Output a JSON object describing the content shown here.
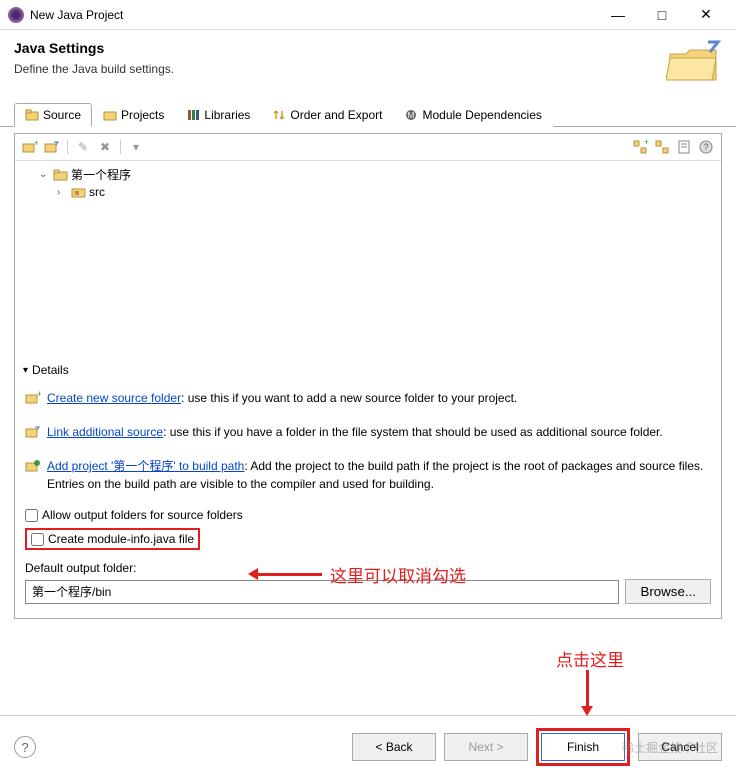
{
  "window": {
    "title": "New Java Project"
  },
  "header": {
    "title": "Java Settings",
    "subtitle": "Define the Java build settings."
  },
  "tabs": {
    "source": "Source",
    "projects": "Projects",
    "libraries": "Libraries",
    "order": "Order and Export",
    "module": "Module Dependencies"
  },
  "tree": {
    "root": "第一个程序",
    "child": "src"
  },
  "details": {
    "header": "Details",
    "create_link": "Create new source folder",
    "create_rest": ": use this if you want to add a new source folder to your project.",
    "link_link": "Link additional source",
    "link_rest": ": use this if you have a folder in the file system that should be used as additional source folder.",
    "add_link": "Add project '第一个程序' to build path",
    "add_rest": ": Add the project to the build path if the project is the root of packages and source files. Entries on the build path are visible to the compiler and used for building."
  },
  "checks": {
    "allow_output": "Allow output folders for source folders",
    "create_module": "Create module-info.java file"
  },
  "output": {
    "label": "Default output folder:",
    "value": "第一个程序/bin",
    "browse": "Browse..."
  },
  "buttons": {
    "back": "< Back",
    "next": "Next >",
    "finish": "Finish",
    "cancel": "Cancel"
  },
  "annotations": {
    "a1": "这里可以取消勾选",
    "a2": "点击这里"
  },
  "watermark": "稀土掘金技术社区"
}
